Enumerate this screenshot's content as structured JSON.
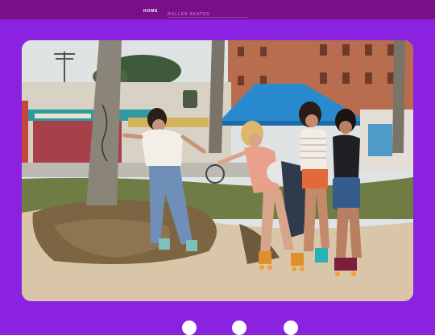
{
  "nav": {
    "home_label": "HOME",
    "roller_label": "ROLLER SKATES"
  },
  "colors": {
    "background": "#8a22e0",
    "topbar": "#7a1088",
    "nav_active": "#ffffff",
    "nav_inactive": "#b96fd0"
  },
  "photo": {
    "alt": "Four women on roller skates stepping down a sandy slope by a boardwalk with palm trees and a blue canopy"
  }
}
